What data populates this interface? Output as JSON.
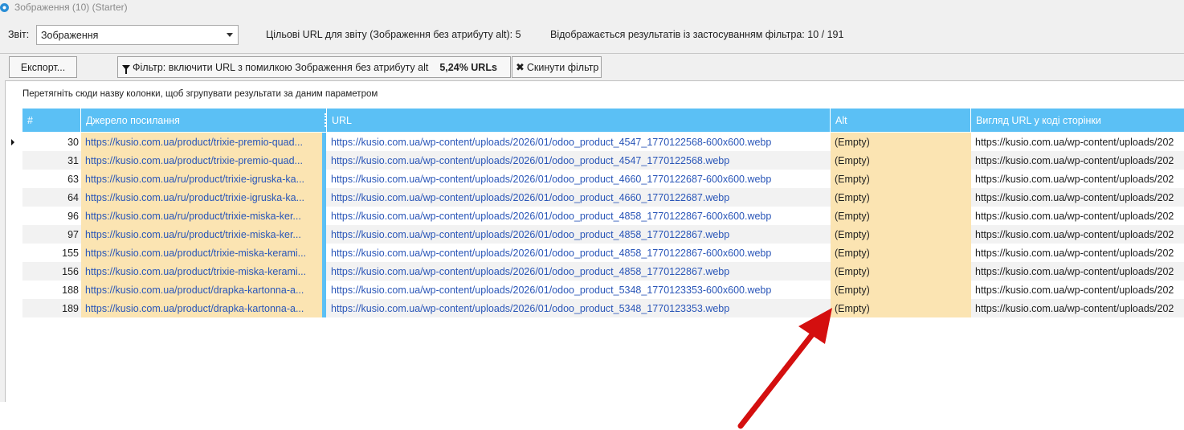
{
  "window": {
    "title": "Зображення (10) (Starter)"
  },
  "report": {
    "label": "Звіт:",
    "selected": "Зображення",
    "target_text": "Цільові URL для звіту (Зображення без атрибуту alt): 5",
    "shown_text": "Відображається результатів із застосуванням фільтра: 10 / 191"
  },
  "toolbar": {
    "export_label": "Експорт...",
    "filter_label": "Фільтр: включити URL з помилкою Зображення без атрибуту alt",
    "filter_percent": "5,24% URLs",
    "reset_label": "Скинути фільтр"
  },
  "grid": {
    "group_hint": "Перетягніть сюди назву колонки, щоб згрупувати результати за даним параметром",
    "columns": [
      "#",
      "Джерело посилання",
      "URL",
      "Alt",
      "Вигляд URL у коді сторінки"
    ],
    "rows": [
      {
        "num": "30",
        "source": "https://kusio.com.ua/product/trixie-premio-quad...",
        "url": "https://kusio.com.ua/wp-content/uploads/2026/01/odoo_product_4547_1770122568-600x600.webp",
        "alt": "(Empty)",
        "view": "https://kusio.com.ua/wp-content/uploads/202"
      },
      {
        "num": "31",
        "source": "https://kusio.com.ua/product/trixie-premio-quad...",
        "url": "https://kusio.com.ua/wp-content/uploads/2026/01/odoo_product_4547_1770122568.webp",
        "alt": "(Empty)",
        "view": "https://kusio.com.ua/wp-content/uploads/202"
      },
      {
        "num": "63",
        "source": "https://kusio.com.ua/ru/product/trixie-igruska-ka...",
        "url": "https://kusio.com.ua/wp-content/uploads/2026/01/odoo_product_4660_1770122687-600x600.webp",
        "alt": "(Empty)",
        "view": "https://kusio.com.ua/wp-content/uploads/202"
      },
      {
        "num": "64",
        "source": "https://kusio.com.ua/ru/product/trixie-igruska-ka...",
        "url": "https://kusio.com.ua/wp-content/uploads/2026/01/odoo_product_4660_1770122687.webp",
        "alt": "(Empty)",
        "view": "https://kusio.com.ua/wp-content/uploads/202"
      },
      {
        "num": "96",
        "source": "https://kusio.com.ua/ru/product/trixie-miska-ker...",
        "url": "https://kusio.com.ua/wp-content/uploads/2026/01/odoo_product_4858_1770122867-600x600.webp",
        "alt": "(Empty)",
        "view": "https://kusio.com.ua/wp-content/uploads/202"
      },
      {
        "num": "97",
        "source": "https://kusio.com.ua/ru/product/trixie-miska-ker...",
        "url": "https://kusio.com.ua/wp-content/uploads/2026/01/odoo_product_4858_1770122867.webp",
        "alt": "(Empty)",
        "view": "https://kusio.com.ua/wp-content/uploads/202"
      },
      {
        "num": "155",
        "source": "https://kusio.com.ua/product/trixie-miska-kerami...",
        "url": "https://kusio.com.ua/wp-content/uploads/2026/01/odoo_product_4858_1770122867-600x600.webp",
        "alt": "(Empty)",
        "view": "https://kusio.com.ua/wp-content/uploads/202"
      },
      {
        "num": "156",
        "source": "https://kusio.com.ua/product/trixie-miska-kerami...",
        "url": "https://kusio.com.ua/wp-content/uploads/2026/01/odoo_product_4858_1770122867.webp",
        "alt": "(Empty)",
        "view": "https://kusio.com.ua/wp-content/uploads/202"
      },
      {
        "num": "188",
        "source": "https://kusio.com.ua/product/drapka-kartonna-a...",
        "url": "https://kusio.com.ua/wp-content/uploads/2026/01/odoo_product_5348_1770123353-600x600.webp",
        "alt": "(Empty)",
        "view": "https://kusio.com.ua/wp-content/uploads/202"
      },
      {
        "num": "189",
        "source": "https://kusio.com.ua/product/drapka-kartonna-a...",
        "url": "https://kusio.com.ua/wp-content/uploads/2026/01/odoo_product_5348_1770123353.webp",
        "alt": "(Empty)",
        "view": "https://kusio.com.ua/wp-content/uploads/202"
      }
    ]
  },
  "colors": {
    "header": "#5bc0f5",
    "highlight": "#fbe4b2",
    "link": "#2a56b8",
    "annotation_arrow": "#d40f0f"
  }
}
